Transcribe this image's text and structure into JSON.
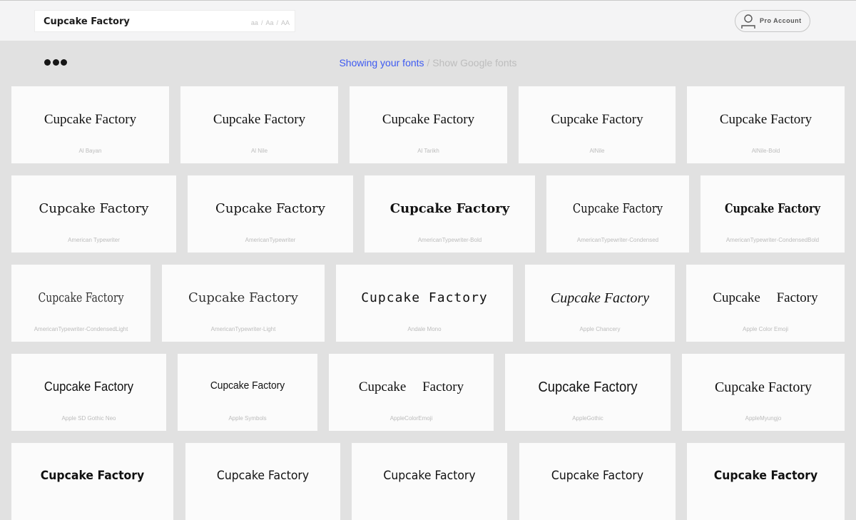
{
  "header": {
    "search_value": "Cupcake Factory",
    "case_options": [
      "aa",
      "Aa",
      "AA"
    ],
    "account_label": "Pro Account"
  },
  "source_toggle": {
    "active": "Showing your fonts",
    "separator": "/",
    "inactive": "Show Google fonts"
  },
  "sample_text": "Cupcake Factory",
  "fonts": [
    {
      "name": "Al Bayan",
      "style": "f-serif"
    },
    {
      "name": "Al Nile",
      "style": "f-serif"
    },
    {
      "name": "Al Tarikh",
      "style": "f-serif"
    },
    {
      "name": "AlNile",
      "style": "f-serif"
    },
    {
      "name": "AlNile-Bold",
      "style": "f-serif"
    },
    {
      "name": "American Typewriter",
      "style": "f-typewriter"
    },
    {
      "name": "AmericanTypewriter",
      "style": "f-typewriter"
    },
    {
      "name": "AmericanTypewriter-Bold",
      "style": "f-typewriter-bold"
    },
    {
      "name": "AmericanTypewriter-Condensed",
      "style": "f-typewriter-cond"
    },
    {
      "name": "AmericanTypewriter-CondensedBold",
      "style": "f-typewriter-condbold"
    },
    {
      "name": "AmericanTypewriter-CondensedLight",
      "style": "f-typewriter-condlight"
    },
    {
      "name": "AmericanTypewriter-Light",
      "style": "f-typewriter-light"
    },
    {
      "name": "Andale Mono",
      "style": "f-mono"
    },
    {
      "name": "Apple Chancery",
      "style": "f-chancery"
    },
    {
      "name": "Apple Color Emoji",
      "style": "f-emoji"
    },
    {
      "name": "Apple SD Gothic Neo",
      "style": "f-sansn"
    },
    {
      "name": "Apple Symbols",
      "style": "f-sansn-sm"
    },
    {
      "name": "AppleColorEmoji",
      "style": "f-emoji"
    },
    {
      "name": "AppleGothic",
      "style": "f-gothic"
    },
    {
      "name": "AppleMyungjo",
      "style": "f-myungjo"
    },
    {
      "name": "",
      "style": "f-sans-bold"
    },
    {
      "name": "",
      "style": "f-sans"
    },
    {
      "name": "",
      "style": "f-sans"
    },
    {
      "name": "",
      "style": "f-sans"
    },
    {
      "name": "",
      "style": "f-sans-bold"
    }
  ]
}
